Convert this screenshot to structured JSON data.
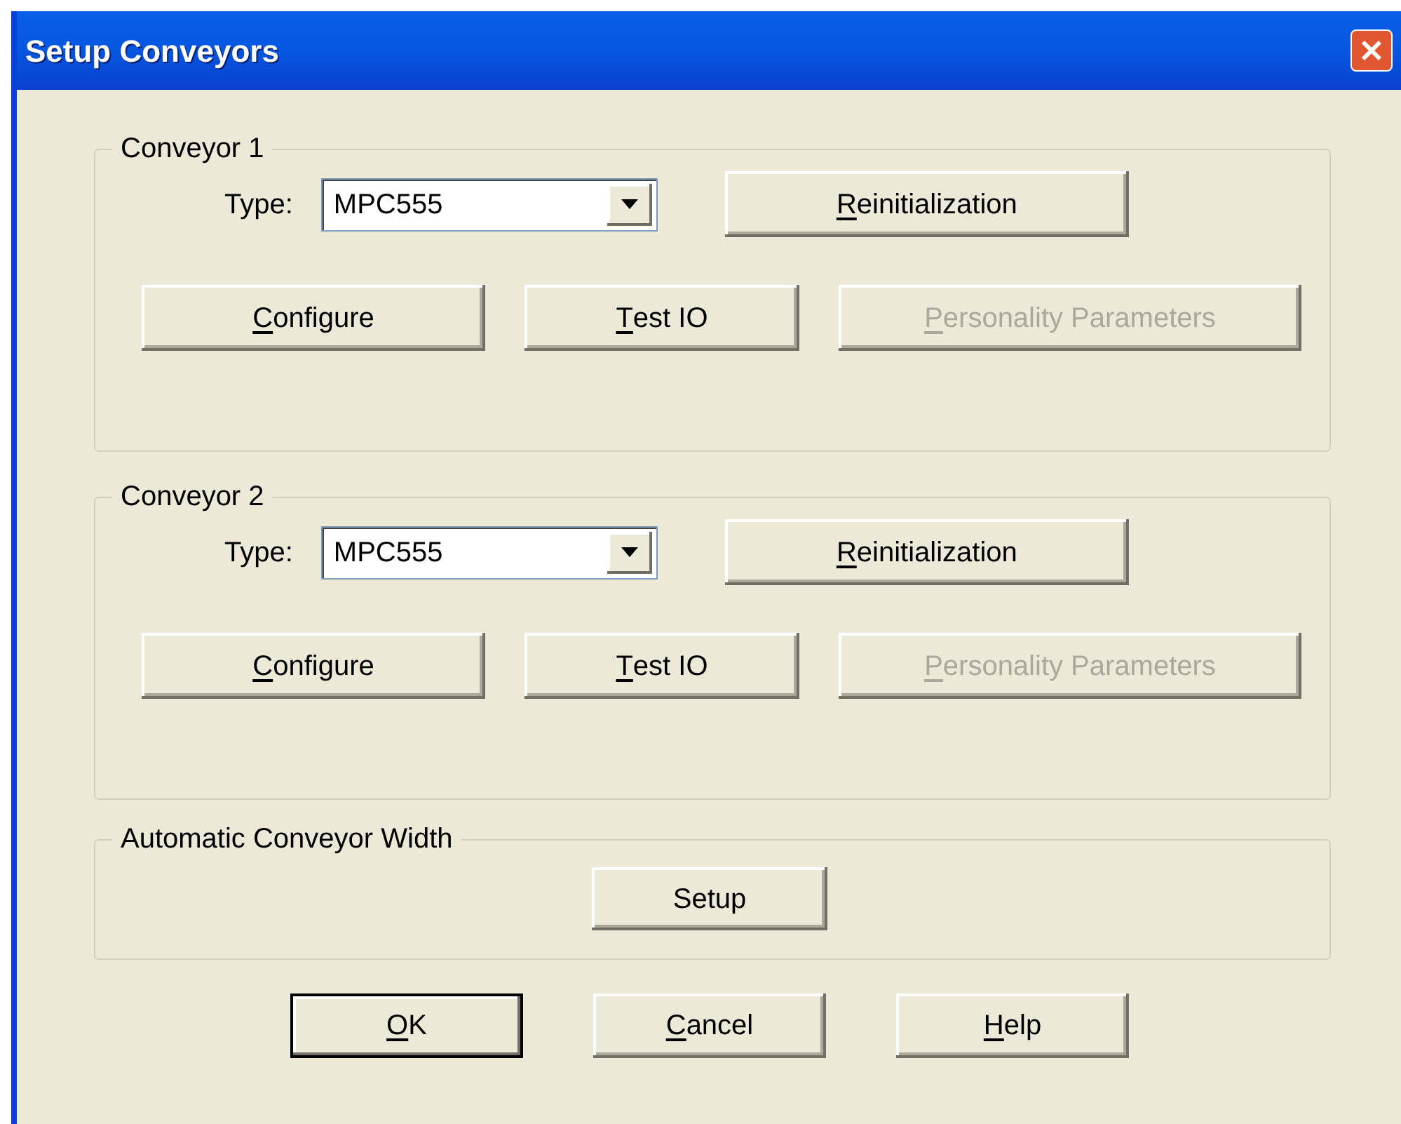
{
  "window": {
    "title": "Setup Conveyors"
  },
  "conveyors": [
    {
      "title": "Conveyor 1",
      "type_label": "Type:",
      "type_value": "MPC555",
      "reset_button": {
        "label": "Reinitialization",
        "underline_first": true,
        "disabled": false
      },
      "buttons": [
        {
          "label": "Configure",
          "underline_first": true,
          "disabled": false
        },
        {
          "label": "Test IO",
          "underline_first": true,
          "disabled": false
        },
        {
          "label": "Personality Parameters",
          "underline_first": true,
          "disabled": true
        }
      ]
    },
    {
      "title": "Conveyor 2",
      "type_label": "Type:",
      "type_value": "MPC555",
      "reset_button": {
        "label": "Reinitialization",
        "underline_first": true,
        "disabled": false
      },
      "buttons": [
        {
          "label": "Configure",
          "underline_first": true,
          "disabled": false
        },
        {
          "label": "Test IO",
          "underline_first": true,
          "disabled": false
        },
        {
          "label": "Personality Parameters",
          "underline_first": true,
          "disabled": true
        }
      ]
    }
  ],
  "width_group": {
    "title": "Automatic Conveyor Width",
    "button": {
      "label": "Setup",
      "underline_first": false,
      "disabled": false
    }
  },
  "dialog_buttons": [
    {
      "label": "OK",
      "underline_first": true,
      "disabled": false,
      "default": true
    },
    {
      "label": "Cancel",
      "underline_first": true,
      "disabled": false,
      "default": false
    },
    {
      "label": "Help",
      "underline_first": true,
      "disabled": false,
      "default": false
    }
  ]
}
